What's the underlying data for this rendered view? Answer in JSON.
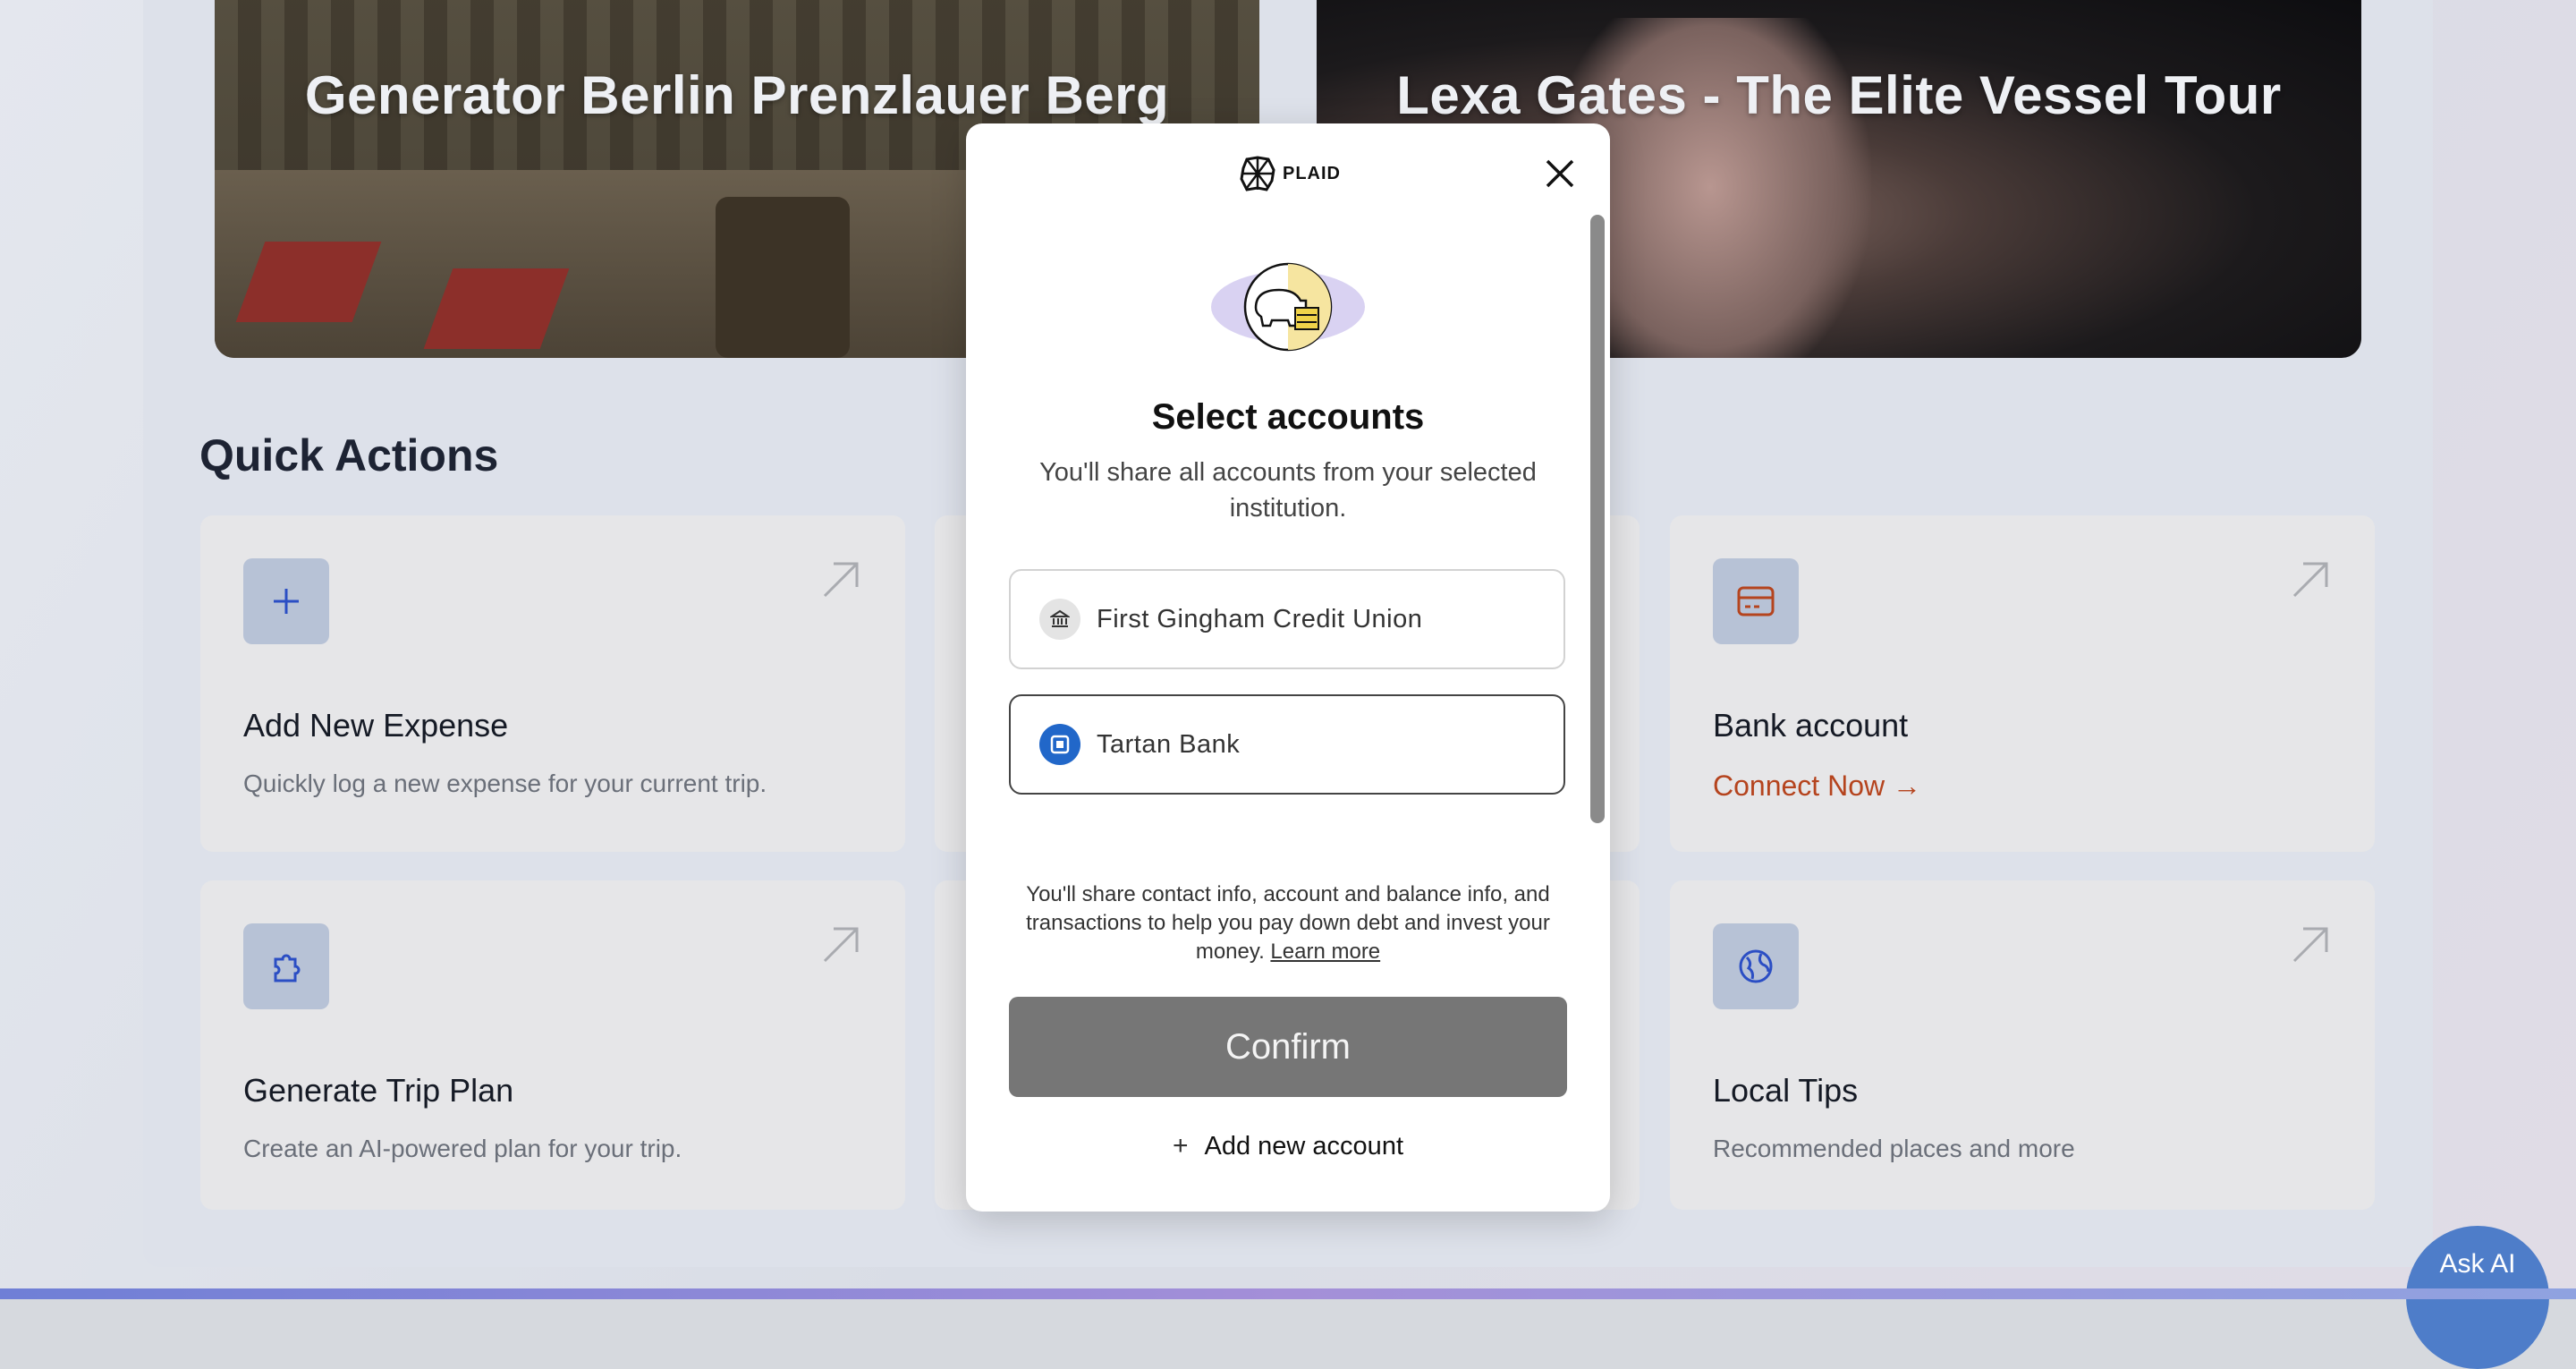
{
  "hero": {
    "left_title": "Generator Berlin Prenzlauer Berg",
    "right_title": "Lexa Gates - The Elite Vessel Tour"
  },
  "quick_actions": {
    "title": "Quick Actions",
    "cards": [
      {
        "title": "Add New Expense",
        "description": "Quickly log a new expense for your current trip.",
        "icon": "plus-icon"
      },
      {
        "title": "Bank account",
        "link": "Connect Now →",
        "icon": "credit-card-icon"
      },
      {
        "title": "Generate Trip Plan",
        "description": "Create an AI-powered plan for your trip.",
        "icon": "puzzle-icon"
      },
      {
        "title": "Local Tips",
        "description": "Recommended places and more",
        "icon": "globe-icon"
      }
    ]
  },
  "modal": {
    "brand": "PLAID",
    "title": "Select accounts",
    "subtitle": "You'll share all accounts from your selected institution.",
    "accounts": [
      {
        "label": "First Gingham Credit Union",
        "icon": "bank-icon"
      },
      {
        "label": "Tartan Bank",
        "icon": "tartan-bank-icon"
      }
    ],
    "disclaimer": "You'll share contact info, account and balance info, and transactions to help you pay down debt and invest your money.",
    "learn_more": "Learn more",
    "confirm_label": "Confirm",
    "add_account_label": "Add new account"
  },
  "ask_ai": {
    "label": "Ask AI"
  },
  "colors": {
    "accent_link": "#b5441e",
    "confirm_bg": "#767676",
    "ask_ai_bg": "#4e7dc9"
  }
}
